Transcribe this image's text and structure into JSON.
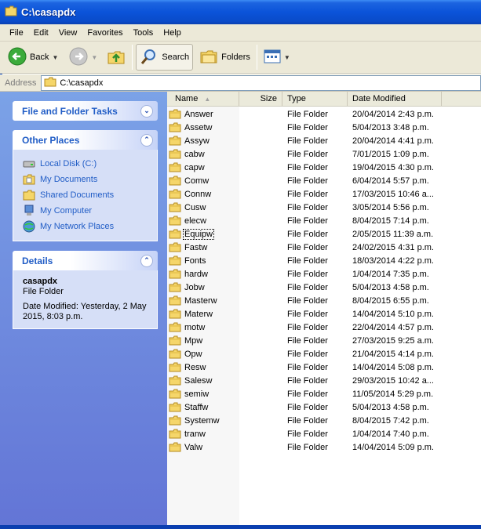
{
  "window": {
    "title": "C:\\casapdx"
  },
  "menu": [
    "File",
    "Edit",
    "View",
    "Favorites",
    "Tools",
    "Help"
  ],
  "toolbar": {
    "back": "Back",
    "search": "Search",
    "folders": "Folders"
  },
  "address": {
    "label": "Address",
    "value": "C:\\casapdx"
  },
  "tasks": {
    "file_folder_title": "File and Folder Tasks",
    "other_places_title": "Other Places",
    "other_places": [
      "Local Disk (C:)",
      "My Documents",
      "Shared Documents",
      "My Computer",
      "My Network Places"
    ],
    "details_title": "Details",
    "details": {
      "name": "casapdx",
      "type": "File Folder",
      "modified": "Date Modified: Yesterday, 2 May 2015, 8:03 p.m."
    }
  },
  "columns": {
    "name": "Name",
    "size": "Size",
    "type": "Type",
    "date": "Date Modified"
  },
  "files": [
    {
      "name": "Answer",
      "type": "File Folder",
      "date": "20/04/2014 2:43 p.m."
    },
    {
      "name": "Assetw",
      "type": "File Folder",
      "date": "5/04/2013 3:48 p.m."
    },
    {
      "name": "Assyw",
      "type": "File Folder",
      "date": "20/04/2014 4:41 p.m."
    },
    {
      "name": "cabw",
      "type": "File Folder",
      "date": "7/01/2015 1:09 p.m."
    },
    {
      "name": "capw",
      "type": "File Folder",
      "date": "19/04/2015 4:30 p.m."
    },
    {
      "name": "Comw",
      "type": "File Folder",
      "date": "6/04/2014 5:57 p.m."
    },
    {
      "name": "Connw",
      "type": "File Folder",
      "date": "17/03/2015 10:46 a..."
    },
    {
      "name": "Cusw",
      "type": "File Folder",
      "date": "3/05/2014 5:56 p.m."
    },
    {
      "name": "elecw",
      "type": "File Folder",
      "date": "8/04/2015 7:14 p.m."
    },
    {
      "name": "Equipw",
      "type": "File Folder",
      "date": "2/05/2015 11:39 a.m."
    },
    {
      "name": "Fastw",
      "type": "File Folder",
      "date": "24/02/2015 4:31 p.m."
    },
    {
      "name": "Fonts",
      "type": "File Folder",
      "date": "18/03/2014 4:22 p.m."
    },
    {
      "name": "hardw",
      "type": "File Folder",
      "date": "1/04/2014 7:35 p.m."
    },
    {
      "name": "Jobw",
      "type": "File Folder",
      "date": "5/04/2013 4:58 p.m."
    },
    {
      "name": "Masterw",
      "type": "File Folder",
      "date": "8/04/2015 6:55 p.m."
    },
    {
      "name": "Materw",
      "type": "File Folder",
      "date": "14/04/2014 5:10 p.m."
    },
    {
      "name": "motw",
      "type": "File Folder",
      "date": "22/04/2014 4:57 p.m."
    },
    {
      "name": "Mpw",
      "type": "File Folder",
      "date": "27/03/2015 9:25 a.m."
    },
    {
      "name": "Opw",
      "type": "File Folder",
      "date": "21/04/2015 4:14 p.m."
    },
    {
      "name": "Resw",
      "type": "File Folder",
      "date": "14/04/2014 5:08 p.m."
    },
    {
      "name": "Salesw",
      "type": "File Folder",
      "date": "29/03/2015 10:42 a..."
    },
    {
      "name": "semiw",
      "type": "File Folder",
      "date": "11/05/2014 5:29 p.m."
    },
    {
      "name": "Staffw",
      "type": "File Folder",
      "date": "5/04/2013 4:58 p.m."
    },
    {
      "name": "Systemw",
      "type": "File Folder",
      "date": "8/04/2015 7:42 p.m."
    },
    {
      "name": "tranw",
      "type": "File Folder",
      "date": "1/04/2014 7:40 p.m."
    },
    {
      "name": "Valw",
      "type": "File Folder",
      "date": "14/04/2014 5:09 p.m."
    }
  ],
  "focused_file": "Equipw",
  "colors": {
    "title_bar": "#0b53d9",
    "task_link": "#215dc6",
    "folder": "#f5d66a"
  }
}
